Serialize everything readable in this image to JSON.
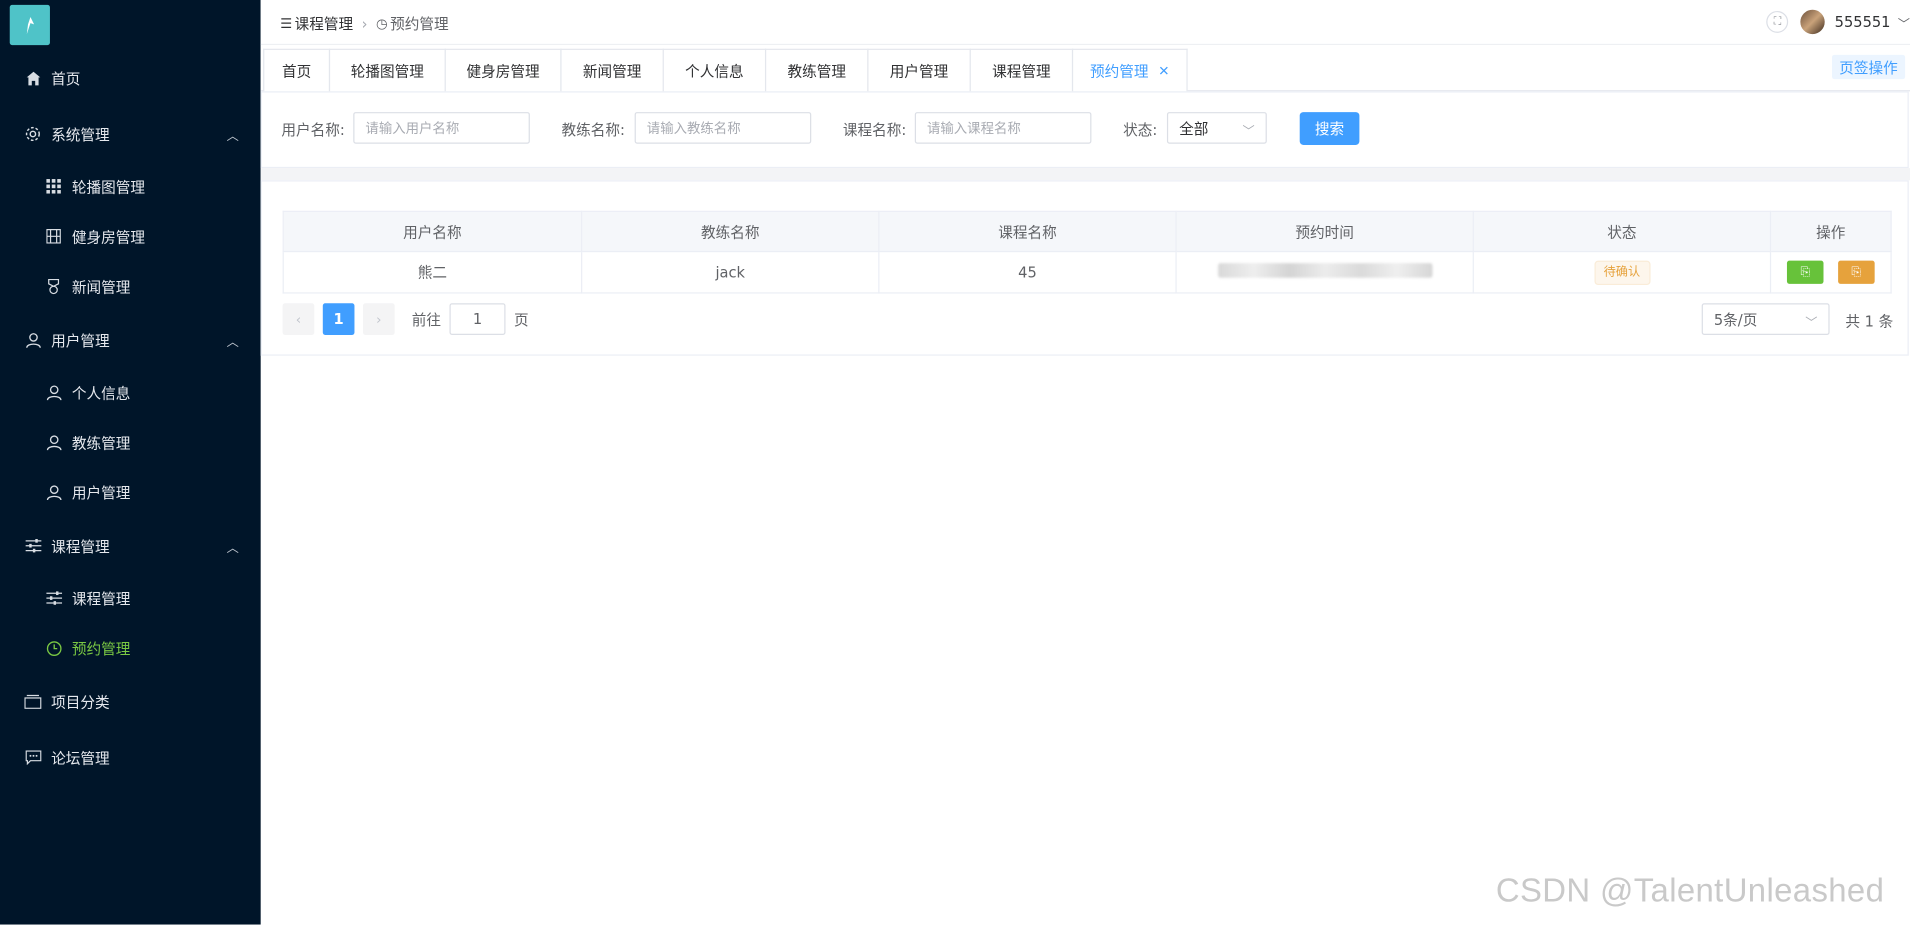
{
  "sidebar": {
    "items": [
      {
        "label": "首页",
        "icon": "home-icon"
      },
      {
        "label": "系统管理",
        "icon": "gear-icon"
      },
      {
        "label": "轮播图管理",
        "icon": "grid-icon"
      },
      {
        "label": "健身房管理",
        "icon": "film-icon"
      },
      {
        "label": "新闻管理",
        "icon": "medal-icon"
      },
      {
        "label": "用户管理",
        "icon": "user-icon"
      },
      {
        "label": "个人信息",
        "icon": "user-icon"
      },
      {
        "label": "教练管理",
        "icon": "user-icon"
      },
      {
        "label": "用户管理",
        "icon": "user-icon"
      },
      {
        "label": "课程管理",
        "icon": "sliders-icon"
      },
      {
        "label": "课程管理",
        "icon": "sliders-icon"
      },
      {
        "label": "预约管理",
        "icon": "clock-icon"
      },
      {
        "label": "项目分类",
        "icon": "folder-icon"
      },
      {
        "label": "论坛管理",
        "icon": "chat-icon"
      }
    ]
  },
  "header": {
    "breadcrumb": [
      "课程管理",
      "预约管理"
    ],
    "username": "555551"
  },
  "tabs": [
    "首页",
    "轮播图管理",
    "健身房管理",
    "新闻管理",
    "个人信息",
    "教练管理",
    "用户管理",
    "课程管理",
    "预约管理"
  ],
  "tab_action": "页签操作",
  "search": {
    "user_label": "用户名称:",
    "user_placeholder": "请输入用户名称",
    "coach_label": "教练名称:",
    "coach_placeholder": "请输入教练名称",
    "course_label": "课程名称:",
    "course_placeholder": "请输入课程名称",
    "status_label": "状态:",
    "status_value": "全部",
    "search_button": "搜索"
  },
  "table": {
    "headers": [
      "用户名称",
      "教练名称",
      "课程名称",
      "预约时间",
      "状态",
      "操作"
    ],
    "rows": [
      {
        "user": "熊二",
        "coach": "jack",
        "course": "45",
        "status": "待确认"
      }
    ]
  },
  "pagination": {
    "current": "1",
    "goto_label": "前往",
    "goto_value": "1",
    "page_unit": "页",
    "page_size": "5条/页",
    "total": "共 1 条"
  },
  "watermark": "CSDN @TalentUnleashed",
  "colors": {
    "sidebar_bg": "#001529",
    "active_menu": "#7ac943",
    "primary": "#409eff",
    "warning": "#e6a23c",
    "success": "#67c23a"
  }
}
